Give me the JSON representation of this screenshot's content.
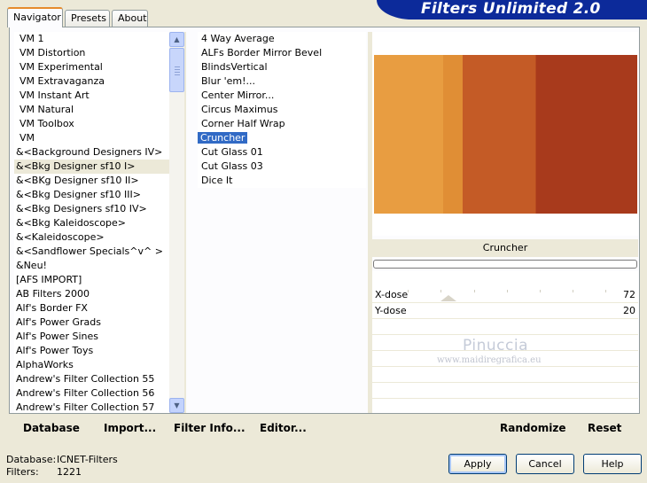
{
  "window": {
    "banner_title": "Filters Unlimited 2.0"
  },
  "tabs": [
    {
      "label": "Navigator",
      "active": true
    },
    {
      "label": "Presets",
      "active": false
    },
    {
      "label": "About",
      "active": false
    }
  ],
  "categories": [
    "VM 1",
    "VM Distortion",
    "VM Experimental",
    "VM Extravaganza",
    "VM Instant Art",
    "VM Natural",
    "VM Toolbox",
    "VM",
    "&<Background Designers IV>",
    "&<Bkg Designer sf10 I>",
    "&<BKg Designer sf10 II>",
    "&<Bkg Designer sf10 III>",
    "&<Bkg Designers sf10 IV>",
    "&<Bkg Kaleidoscope>",
    "&<Kaleidoscope>",
    "&<Sandflower Specials^v^ >",
    "&Neu!",
    "[AFS IMPORT]",
    "AB Filters 2000",
    "Alf's Border FX",
    "Alf's Power Grads",
    "Alf's Power Sines",
    "Alf's Power Toys",
    "AlphaWorks",
    "Andrew's Filter Collection 55",
    "Andrew's Filter Collection 56",
    "Andrew's Filter Collection 57"
  ],
  "selected_category_index": 9,
  "filters": [
    "4 Way Average",
    "ALFs Border Mirror Bevel",
    "BlindsVertical",
    "Blur 'em!...",
    "Center Mirror...",
    "Circus Maximus",
    "Corner Half Wrap",
    "Cruncher",
    "Cut Glass 01",
    "Cut Glass 03",
    "Dice It"
  ],
  "selected_filter_index": 7,
  "preview": {
    "filter_name": "Cruncher",
    "colors": [
      "#e89d41",
      "#e08e35",
      "#c45b26",
      "#b84a20",
      "#a83a1c"
    ],
    "progress": 0
  },
  "parameters": [
    {
      "label": "X-dose",
      "value": "72"
    },
    {
      "label": "Y-dose",
      "value": "20"
    }
  ],
  "watermark": {
    "line1": "Pinuccia",
    "line2": "www.maidiregrafica.eu"
  },
  "toolbar": {
    "database": "Database",
    "import": "Import...",
    "filter_info": "Filter Info...",
    "editor": "Editor...",
    "randomize": "Randomize",
    "reset": "Reset"
  },
  "status": {
    "database_label": "Database:",
    "database_value": "ICNET-Filters",
    "filters_label": "Filters:",
    "filters_value": "1221"
  },
  "buttons": {
    "apply": "Apply",
    "cancel": "Cancel",
    "help": "Help"
  }
}
